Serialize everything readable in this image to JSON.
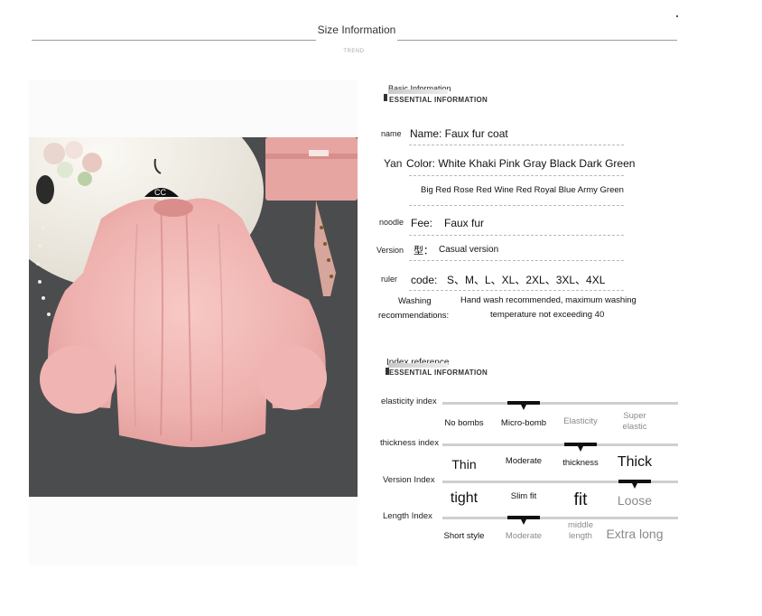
{
  "header": {
    "title": "Size Information",
    "subtitle": "TREND"
  },
  "photo": {
    "alt": "pink faux fur coat on hanger",
    "accent_colors": {
      "coat": "#efb3b3",
      "background": "#4b4c4e",
      "rug": "#f2efe8",
      "bag": "#e8a7a4"
    }
  },
  "basic": {
    "title": "Basic Information",
    "subtitle": "ESSENTIAL INFORMATION",
    "rows": {
      "name": {
        "label": "name",
        "value": "Name: Faux fur coat"
      },
      "color": {
        "label": "Yan",
        "value": "Color: White Khaki Pink Gray Black Dark Green",
        "value2": "Big Red Rose Red Wine Red Royal Blue Army Green"
      },
      "fabric": {
        "label": "noodle",
        "prefix": "Fee:",
        "value": "Faux fur"
      },
      "version": {
        "label": "Version",
        "prefix": "型：",
        "value": "Casual version"
      },
      "size": {
        "label": "ruler",
        "prefix": "code:",
        "value": "S、M、L、XL、2XL、3XL、4XL"
      },
      "washing": {
        "label1": "Washing",
        "label2": "recommendations:",
        "value1": "Hand wash recommended, maximum washing",
        "value2": "temperature not exceeding 40"
      }
    }
  },
  "index": {
    "title": "Index reference",
    "subtitle": "ESSENTIAL INFORMATION",
    "rows": [
      {
        "label": "elasticity index",
        "selected": 1,
        "options": [
          {
            "text": "No bombs"
          },
          {
            "text": "Micro-bomb"
          },
          {
            "text": "Elasticity",
            "dim": true
          },
          {
            "text": "Super elastic",
            "dim": true
          }
        ]
      },
      {
        "label": "thickness index",
        "selected": 2,
        "options": [
          {
            "text": "Thin"
          },
          {
            "text": "Moderate"
          },
          {
            "text": "thickness"
          },
          {
            "text": "Thick"
          }
        ]
      },
      {
        "label": "Version Index",
        "selected": 3,
        "options": [
          {
            "text": "tight"
          },
          {
            "text": "Slim fit"
          },
          {
            "text": "fit"
          },
          {
            "text": "Loose",
            "dim": true
          }
        ]
      },
      {
        "label": "Length Index",
        "selected": 1,
        "options": [
          {
            "text": "Short style"
          },
          {
            "text": "Moderate",
            "dim": true
          },
          {
            "text": "middle length",
            "dim": true
          },
          {
            "text": "Extra long",
            "dim": true
          }
        ]
      }
    ]
  }
}
